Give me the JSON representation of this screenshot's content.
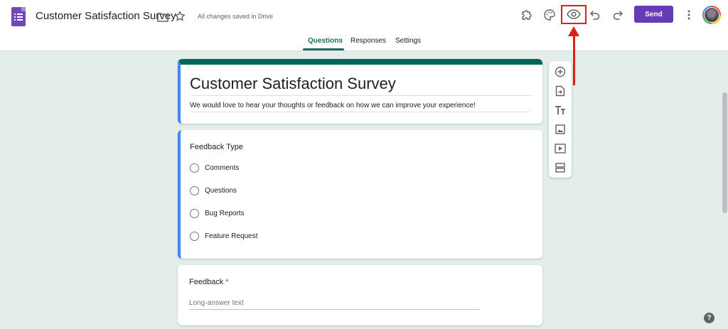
{
  "header": {
    "app_icon": "google-forms-icon",
    "title": "Customer Satisfaction Survey",
    "saved_status": "All changes saved in Drive",
    "send_label": "Send",
    "icons": [
      "folder-icon",
      "star-icon",
      "addon-puzzle-icon",
      "palette-icon",
      "preview-eye-icon",
      "undo-icon",
      "redo-icon",
      "more-vert-icon"
    ]
  },
  "tabs": [
    {
      "label": "Questions",
      "active": true
    },
    {
      "label": "Responses",
      "active": false
    },
    {
      "label": "Settings",
      "active": false
    }
  ],
  "form": {
    "title": "Customer Satisfaction Survey",
    "description": "We would love to hear your thoughts or feedback on how we can improve your experience!"
  },
  "questions": [
    {
      "title": "Feedback Type",
      "type": "multiple-choice",
      "options": [
        "Comments",
        "Questions",
        "Bug Reports",
        "Feature Request"
      ]
    },
    {
      "title": "Feedback",
      "required_mark": "*",
      "type": "paragraph",
      "placeholder": "Long-answer text"
    }
  ],
  "side_toolbar": [
    "add-question-icon",
    "import-questions-icon",
    "add-title-icon",
    "add-image-icon",
    "add-video-icon",
    "add-section-icon"
  ],
  "colors": {
    "accent": "#673ab7",
    "theme": "#07645a",
    "background": "#e3eeea",
    "annotation": "#e01d1d"
  },
  "help": "?"
}
